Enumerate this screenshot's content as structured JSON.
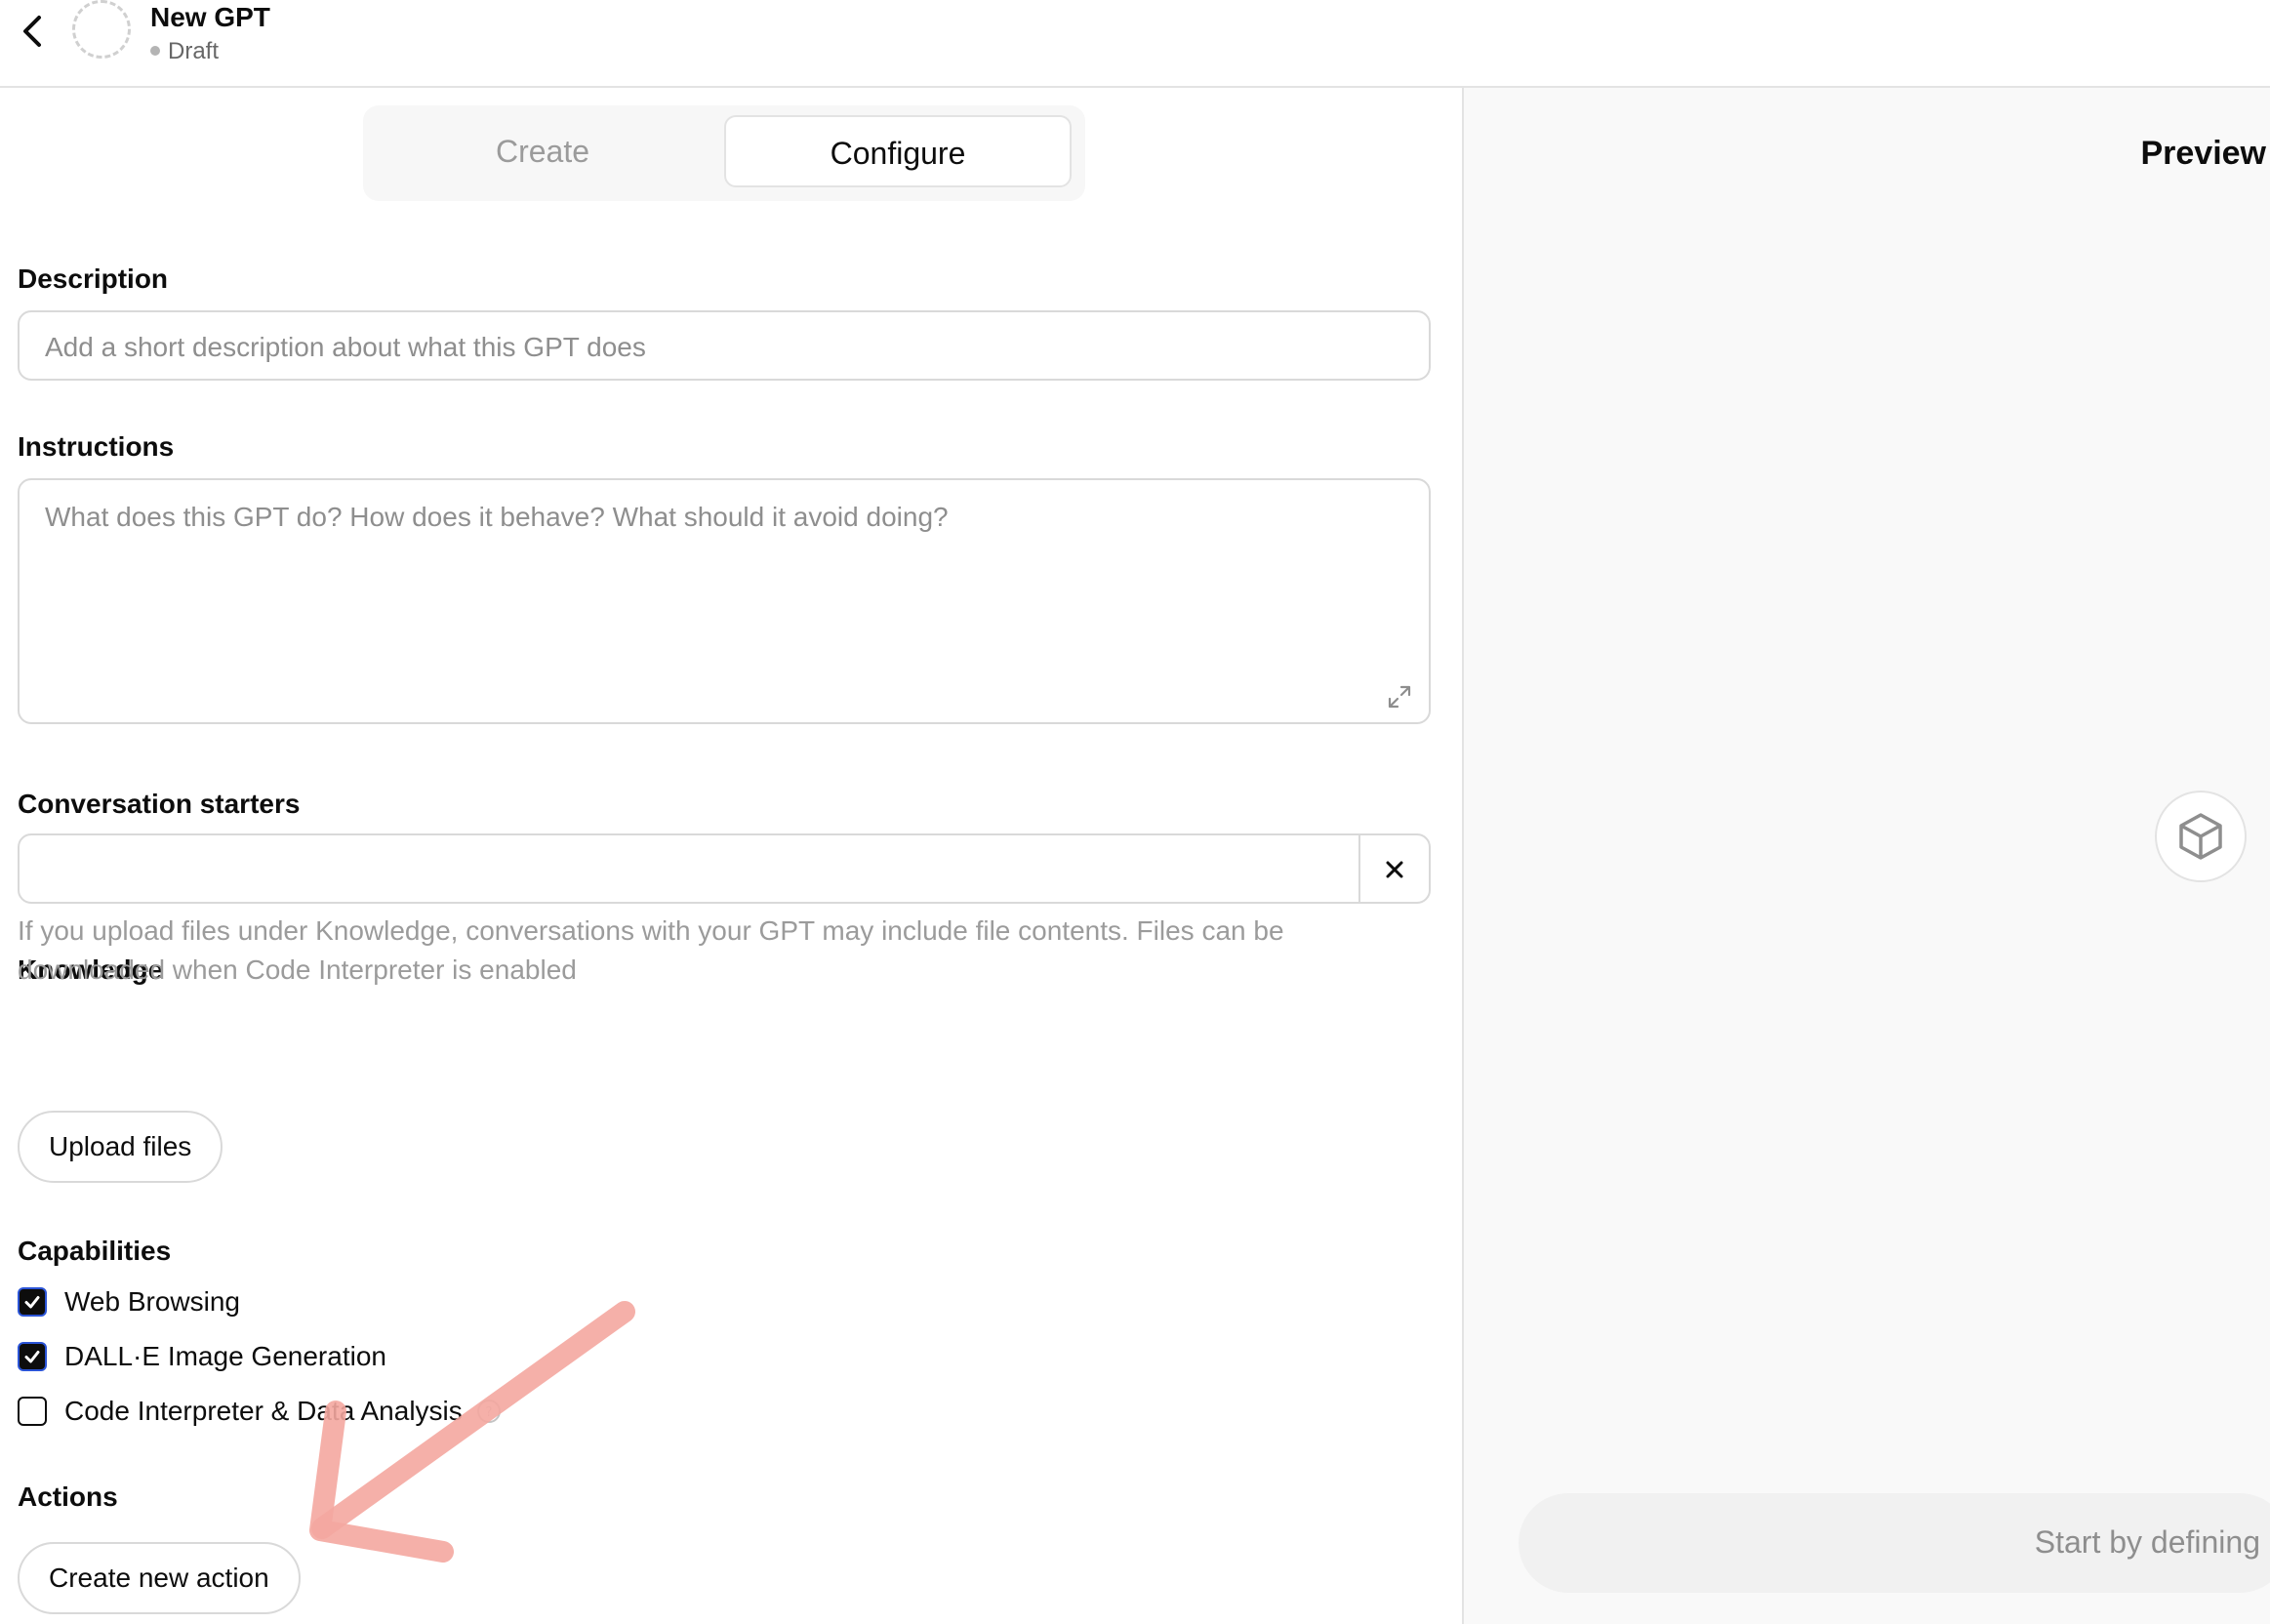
{
  "header": {
    "gpt_name": "New GPT",
    "status": "Draft"
  },
  "tabs": [
    {
      "label": "Create",
      "active": false
    },
    {
      "label": "Configure",
      "active": true
    }
  ],
  "form": {
    "description": {
      "label": "Description",
      "placeholder": "Add a short description about what this GPT does",
      "value": ""
    },
    "instructions": {
      "label": "Instructions",
      "placeholder": "What does this GPT do? How does it behave? What should it avoid doing?",
      "value": ""
    },
    "conversation_starters": {
      "label": "Conversation starters",
      "value": ""
    },
    "knowledge": {
      "label": "Knowledge",
      "helper": "If you upload files under Knowledge, conversations with your GPT may include file contents. Files can be downloaded when Code Interpreter is enabled",
      "upload_button": "Upload files"
    },
    "capabilities": {
      "label": "Capabilities",
      "items": [
        {
          "label": "Web Browsing",
          "checked": true
        },
        {
          "label": "DALL·E Image Generation",
          "checked": true
        },
        {
          "label": "Code Interpreter & Data Analysis",
          "checked": false
        }
      ]
    },
    "actions": {
      "label": "Actions",
      "create_button": "Create new action"
    }
  },
  "preview": {
    "title": "Preview",
    "composer_placeholder": "Start by defining"
  },
  "colors": {
    "accent": "#0d0d0d",
    "checkbox_border": "#2b54d6",
    "annotation_arrow": "#f4a7a0"
  },
  "icons": [
    "back-chevron-icon",
    "expand-icon",
    "close-icon",
    "checkmark-icon",
    "info-icon",
    "cube-icon"
  ]
}
